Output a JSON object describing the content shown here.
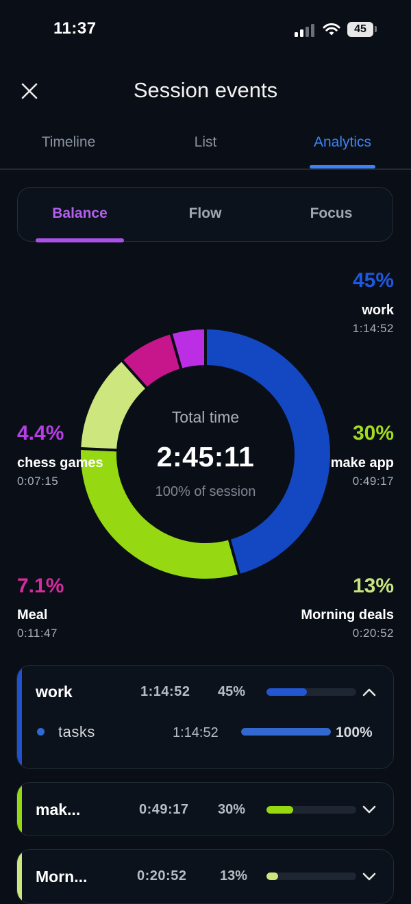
{
  "status_bar": {
    "time": "11:37",
    "battery": "45"
  },
  "header": {
    "title": "Session events"
  },
  "tabs": [
    {
      "label": "Timeline",
      "active": false
    },
    {
      "label": "List",
      "active": false
    },
    {
      "label": "Analytics",
      "active": true
    }
  ],
  "segments": [
    {
      "label": "Balance",
      "active": true
    },
    {
      "label": "Flow",
      "active": false
    },
    {
      "label": "Focus",
      "active": false
    }
  ],
  "chart_data": {
    "type": "pie",
    "variant": "donut",
    "center": {
      "label": "Total time",
      "value": "2:45:11",
      "sublabel": "100% of session"
    },
    "slices": [
      {
        "name": "work",
        "percent_label": "45%",
        "duration": "1:14:52",
        "value": 45.3,
        "color": "#1447c2"
      },
      {
        "name": "make app",
        "percent_label": "30%",
        "duration": "0:49:17",
        "value": 29.8,
        "color": "#96d912"
      },
      {
        "name": "Morning deals",
        "percent_label": "13%",
        "duration": "0:20:52",
        "value": 12.6,
        "color": "#cde67e"
      },
      {
        "name": "Meal",
        "percent_label": "7.1%",
        "duration": "0:11:47",
        "value": 7.1,
        "color": "#c7168b"
      },
      {
        "name": "chess games",
        "percent_label": "4.4%",
        "duration": "0:07:15",
        "value": 4.4,
        "color": "#bc2ee3"
      }
    ]
  },
  "legend_colors": {
    "work": "#1e58e0",
    "make app": "#a2dc1c",
    "Morning deals": "#c6e580",
    "Meal": "#d62a9e",
    "chess games": "#b83de6"
  },
  "list": [
    {
      "name": "work",
      "time": "1:14:52",
      "percent": "45%",
      "fraction": 0.45,
      "color": "#1f52cc",
      "expanded": true,
      "children": [
        {
          "name": "tasks",
          "time": "1:14:52",
          "percent": "100%",
          "fraction": 1.0,
          "color": "#2f6ad4"
        }
      ]
    },
    {
      "name": "mak...",
      "time": "0:49:17",
      "percent": "30%",
      "fraction": 0.3,
      "color": "#96d912",
      "expanded": false
    },
    {
      "name": "Morn...",
      "time": "0:20:52",
      "percent": "13%",
      "fraction": 0.13,
      "color": "#cde67e",
      "expanded": false
    }
  ]
}
